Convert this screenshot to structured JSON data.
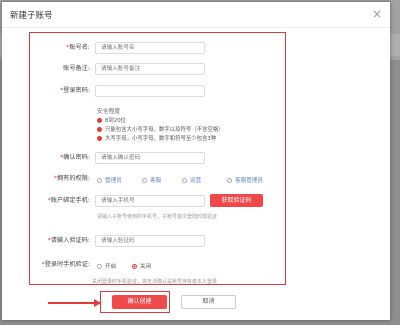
{
  "dialog": {
    "title": "新建子账号",
    "close_glyph": "×"
  },
  "fields": {
    "account_name": {
      "label": "账号名:",
      "placeholder": "请输入账号名"
    },
    "account_note": {
      "label": "账号备注:",
      "placeholder": "请输入账号备注"
    },
    "login_password": {
      "label": "登录密码:",
      "placeholder": ""
    },
    "confirm_password": {
      "label": "确认密码:",
      "placeholder": "请输入确认密码"
    },
    "permissions": {
      "label": "拥有的权限:"
    },
    "phone": {
      "label": "账户绑定手机:",
      "placeholder": "请输入手机号"
    },
    "verify_code": {
      "label": "请输入验证码:",
      "placeholder": "请输入验证码"
    },
    "login_verify": {
      "label": "登录时手机验证:"
    }
  },
  "required_mark": "*",
  "strength": {
    "title": "安全程度",
    "rules": [
      "8到20位",
      "只能包含大小写字母，数字以及符号（不含空格）",
      "大写字母，小写字母，数字和符号至少包含3种"
    ]
  },
  "permissions_options": [
    "管理员",
    "客服",
    "运营",
    "客服管理员"
  ],
  "get_code_button": "获取验证码",
  "phone_hint": "请输入子账号使用的手机号，子账号首次登陆时需验证",
  "login_verify_options": {
    "on": "开启",
    "off": "关闭"
  },
  "footer_note": "关闭登录时手机验证，将无法确认是账号持有者本人登录",
  "buttons": {
    "confirm": "确认创建",
    "cancel": "取消"
  },
  "colors": {
    "accent": "#e23a3a",
    "button": "#ef4b4b",
    "link": "#5a84c9"
  }
}
